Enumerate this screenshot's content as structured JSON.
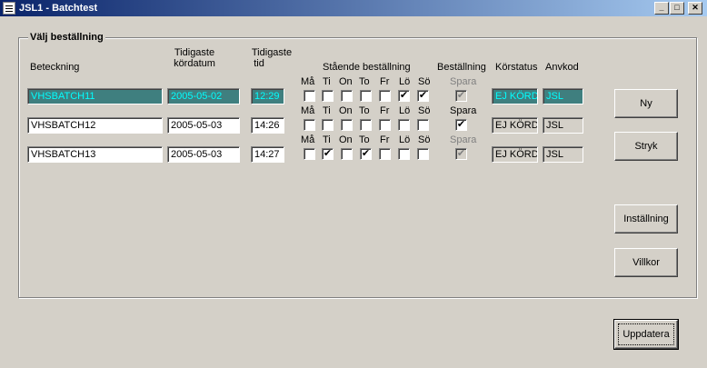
{
  "window": {
    "title": "JSL1 - Batchtest",
    "min_glyph": "_",
    "max_glyph": "□",
    "close_glyph": "✕"
  },
  "group": {
    "title": "Välj beställning"
  },
  "headers": {
    "beteckning": "Beteckning",
    "kordatum_line1": "Tidigaste",
    "kordatum_line2": "kördatum",
    "tid_line1": "Tidigaste",
    "tid_line2": "tid",
    "staende": "Stående beställning",
    "bestallning": "Beställning",
    "korstatus": "Körstatus",
    "anvkod": "Anvkod"
  },
  "days": [
    "Må",
    "Ti",
    "On",
    "To",
    "Fr",
    "Lö",
    "Sö"
  ],
  "spara_label": "Spara",
  "rows": [
    {
      "beteckning": "VHSBATCH11",
      "kordatum": "2005-05-02",
      "tid": "12:29",
      "checked_days": [
        false,
        false,
        false,
        false,
        false,
        true,
        true
      ],
      "spara": true,
      "spara_enabled": false,
      "korstatus": "EJ KÖRD",
      "anvkod": "JSL",
      "selected": true
    },
    {
      "beteckning": "VHSBATCH12",
      "kordatum": "2005-05-03",
      "tid": "14:26",
      "checked_days": [
        false,
        false,
        false,
        false,
        false,
        false,
        false
      ],
      "spara": true,
      "spara_enabled": true,
      "korstatus": "EJ KÖRD",
      "anvkod": "JSL",
      "selected": false
    },
    {
      "beteckning": "VHSBATCH13",
      "kordatum": "2005-05-03",
      "tid": "14:27",
      "checked_days": [
        false,
        true,
        false,
        true,
        false,
        false,
        false
      ],
      "spara": true,
      "spara_enabled": false,
      "korstatus": "EJ KÖRD",
      "anvkod": "JSL",
      "selected": false
    }
  ],
  "buttons": {
    "ny": "Ny",
    "stryk": "Stryk",
    "installning": "Inställning",
    "villkor": "Villkor",
    "uppdatera": "Uppdatera"
  },
  "check_glyph": "✔"
}
